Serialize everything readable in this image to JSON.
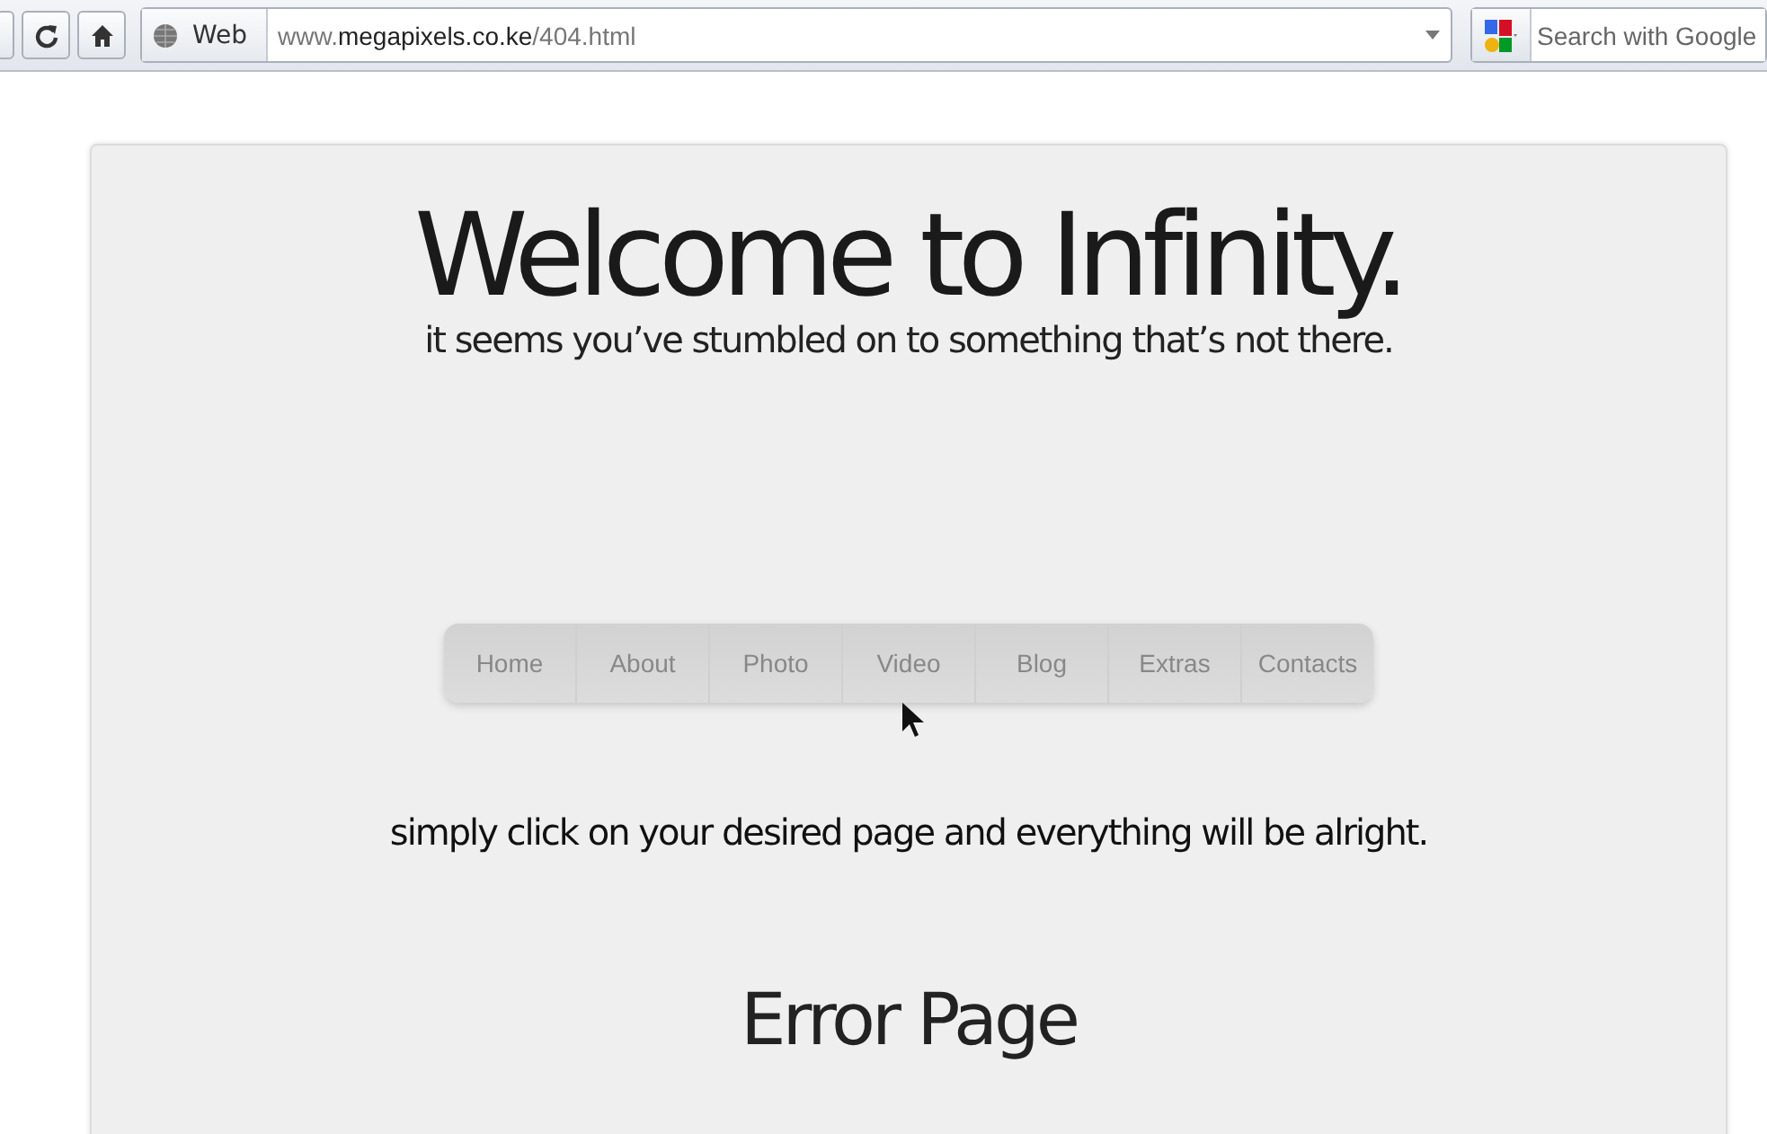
{
  "toolbar": {
    "identity_label": "Web",
    "url": {
      "prefix": "www.",
      "domain": "megapixels.co.ke",
      "path": "/404.html"
    },
    "search": {
      "placeholder": "Search with Google"
    }
  },
  "page": {
    "title": "Welcome to Infinity.",
    "subtitle": "it seems you’ve stumbled on to something that’s not there.",
    "nav": [
      {
        "label": "Home"
      },
      {
        "label": "About"
      },
      {
        "label": "Photo"
      },
      {
        "label": "Video"
      },
      {
        "label": "Blog"
      },
      {
        "label": "Extras"
      },
      {
        "label": "Contacts"
      }
    ],
    "hint": "simply click on your desired page and everything will be alright.",
    "heading": "Error Page"
  }
}
